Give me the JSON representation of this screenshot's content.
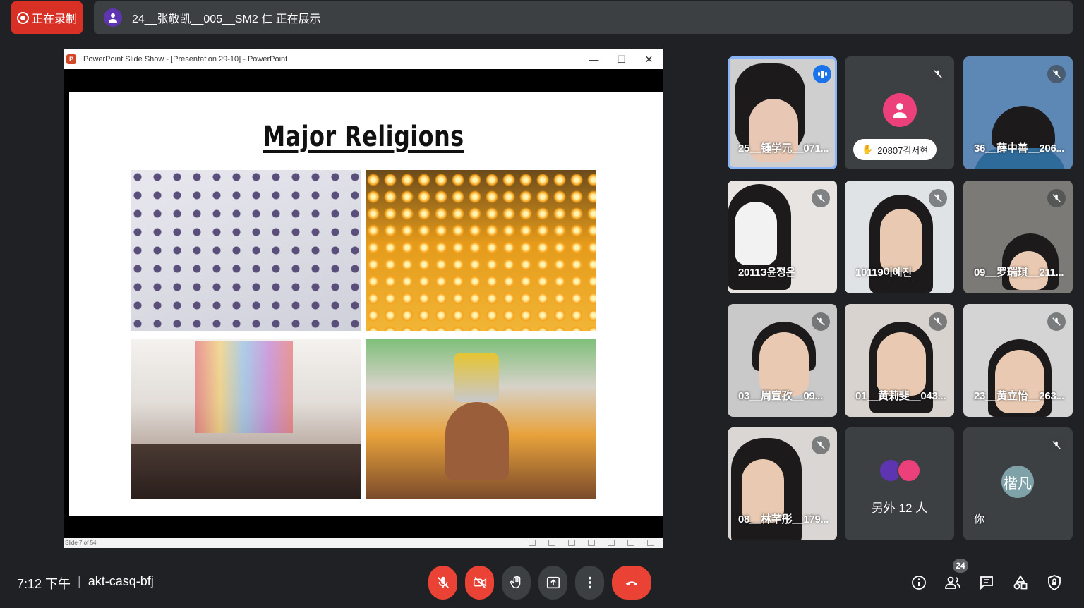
{
  "topbar": {
    "recording_label": "正在录制",
    "presenter_text": "24__张敬凯__005__SM2 仁 正在展示"
  },
  "presentation": {
    "window_title": "PowerPoint Slide Show - [Presentation 29-10] - PowerPoint",
    "slide_title": "Major Religions",
    "status_text": "Slide 7 of 54",
    "controls": {
      "minimize": "—",
      "maximize": "☐",
      "close": "✕"
    }
  },
  "participants": [
    {
      "name": "25__锺学元__071...",
      "state": "speaking"
    },
    {
      "name": "20807김서현",
      "state": "hand-raised"
    },
    {
      "name": "36__薛中善__206...",
      "state": "muted"
    },
    {
      "name": "2011З윤정은",
      "state": "muted"
    },
    {
      "name": "10119이예진",
      "state": "muted"
    },
    {
      "name": "09__罗瑞琪__211...",
      "state": "muted"
    },
    {
      "name": "03__周宣孜__09...",
      "state": "muted"
    },
    {
      "name": "01__黄莉斐__043...",
      "state": "muted"
    },
    {
      "name": "23__黄立怡__263...",
      "state": "muted"
    },
    {
      "name": "08__林芊彤__179...",
      "state": "muted"
    },
    {
      "name": "另外 12 人",
      "state": "others"
    },
    {
      "name": "你",
      "avatar_text": "楷凡",
      "state": "self"
    }
  ],
  "bottombar": {
    "time": "7:12 下午",
    "separator": "|",
    "meeting_code": "akt-casq-bfj",
    "people_count": "24"
  },
  "colors": {
    "background": "#202124",
    "danger": "#ea4335",
    "accent": "#8ab4f8",
    "tile": "#3c4043"
  }
}
